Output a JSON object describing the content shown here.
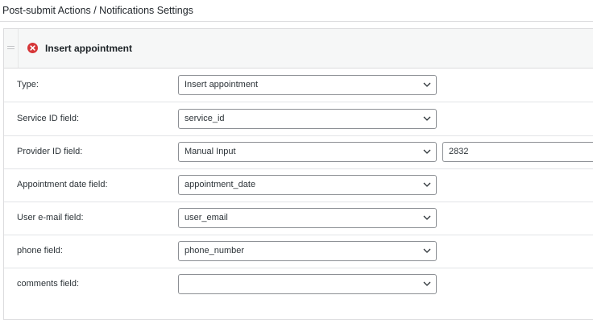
{
  "page": {
    "title": "Post-submit Actions / Notifications Settings"
  },
  "action": {
    "title": "Insert appointment",
    "delete_icon": "delete-circle-x-icon",
    "delete_color": "#d63638",
    "drag_icon": "drag-handle-icon"
  },
  "fields": [
    {
      "label": "Type:",
      "value": "Insert appointment"
    },
    {
      "label": "Service ID field:",
      "value": "service_id"
    },
    {
      "label": "Provider ID field:",
      "value": "Manual Input",
      "extra_input": "2832"
    },
    {
      "label": "Appointment date field:",
      "value": "appointment_date"
    },
    {
      "label": "User e-mail field:",
      "value": "user_email"
    },
    {
      "label": "phone field:",
      "value": "phone_number"
    },
    {
      "label": "comments field:",
      "value": ""
    }
  ],
  "colors": {
    "header_bg": "#f6f7f7",
    "border": "#dcdcde",
    "input_border": "#8c8f94"
  }
}
